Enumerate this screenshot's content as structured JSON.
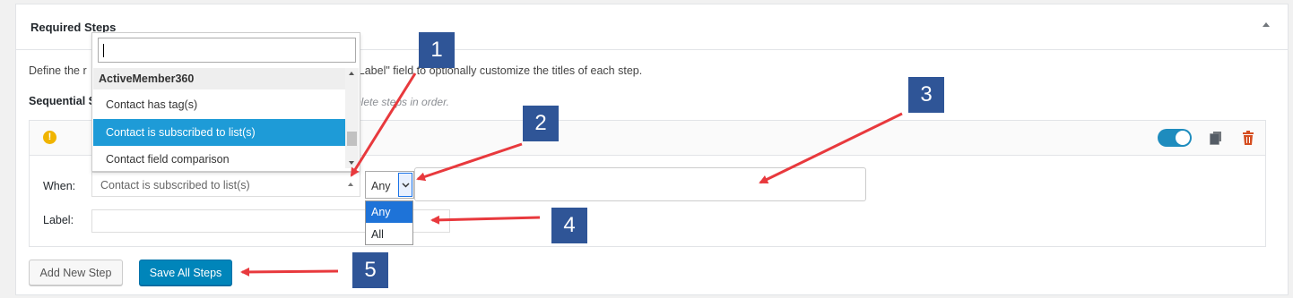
{
  "panel": {
    "title": "Required Steps",
    "description": "Define the r                                                   ed complete. Use the \"Label\" field to optionally customize the titles of each step.",
    "sequential_label": "Sequential S",
    "sequential_hint": "plete steps in order."
  },
  "step": {
    "warning_icon": "exclamation-circle-icon",
    "toggle_state": "on",
    "when_label": "When:",
    "label_label": "Label:",
    "when_value": "Contact is subscribed to list(s)",
    "label_value": "",
    "match_value": "Any"
  },
  "dropdown": {
    "search_value": "",
    "group": "ActiveMember360",
    "items": [
      "Contact has tag(s)",
      "Contact is subscribed to list(s)",
      "Contact field comparison"
    ],
    "highlighted": "Contact is subscribed to list(s)"
  },
  "match_options": [
    "Any",
    "All"
  ],
  "buttons": {
    "add_new": "Add New Step",
    "save_all": "Save All Steps"
  },
  "callouts": [
    "1",
    "2",
    "3",
    "4",
    "5"
  ],
  "colors": {
    "primary": "#0085ba",
    "highlight": "#1e9bd7",
    "callout": "#2f5597",
    "arrow": "#e8393d",
    "warning": "#f0b400",
    "trash": "#d54e21"
  }
}
